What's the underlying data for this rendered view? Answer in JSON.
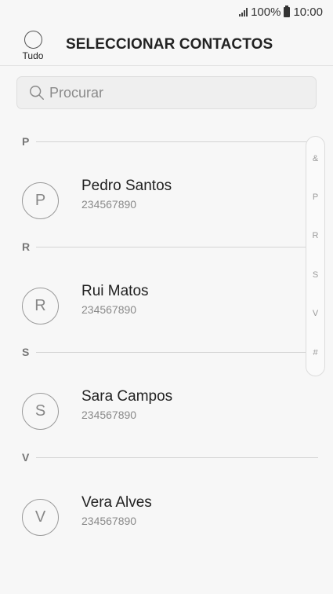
{
  "status_bar": {
    "battery": "100%",
    "time": "10:00"
  },
  "header": {
    "select_all_label": "Tudo",
    "title": "SELECCIONAR CONTACTOS"
  },
  "search": {
    "placeholder": "Procurar"
  },
  "sections": [
    {
      "letter": "P",
      "contacts": [
        {
          "initial": "P",
          "name": "Pedro Santos",
          "phone": "234567890"
        }
      ]
    },
    {
      "letter": "R",
      "contacts": [
        {
          "initial": "R",
          "name": "Rui Matos",
          "phone": "234567890"
        }
      ]
    },
    {
      "letter": "S",
      "contacts": [
        {
          "initial": "S",
          "name": "Sara Campos",
          "phone": "234567890"
        }
      ]
    },
    {
      "letter": "V",
      "contacts": [
        {
          "initial": "V",
          "name": "Vera Alves",
          "phone": "234567890"
        }
      ]
    }
  ],
  "index": [
    "&",
    "P",
    "R",
    "S",
    "V",
    "#"
  ]
}
